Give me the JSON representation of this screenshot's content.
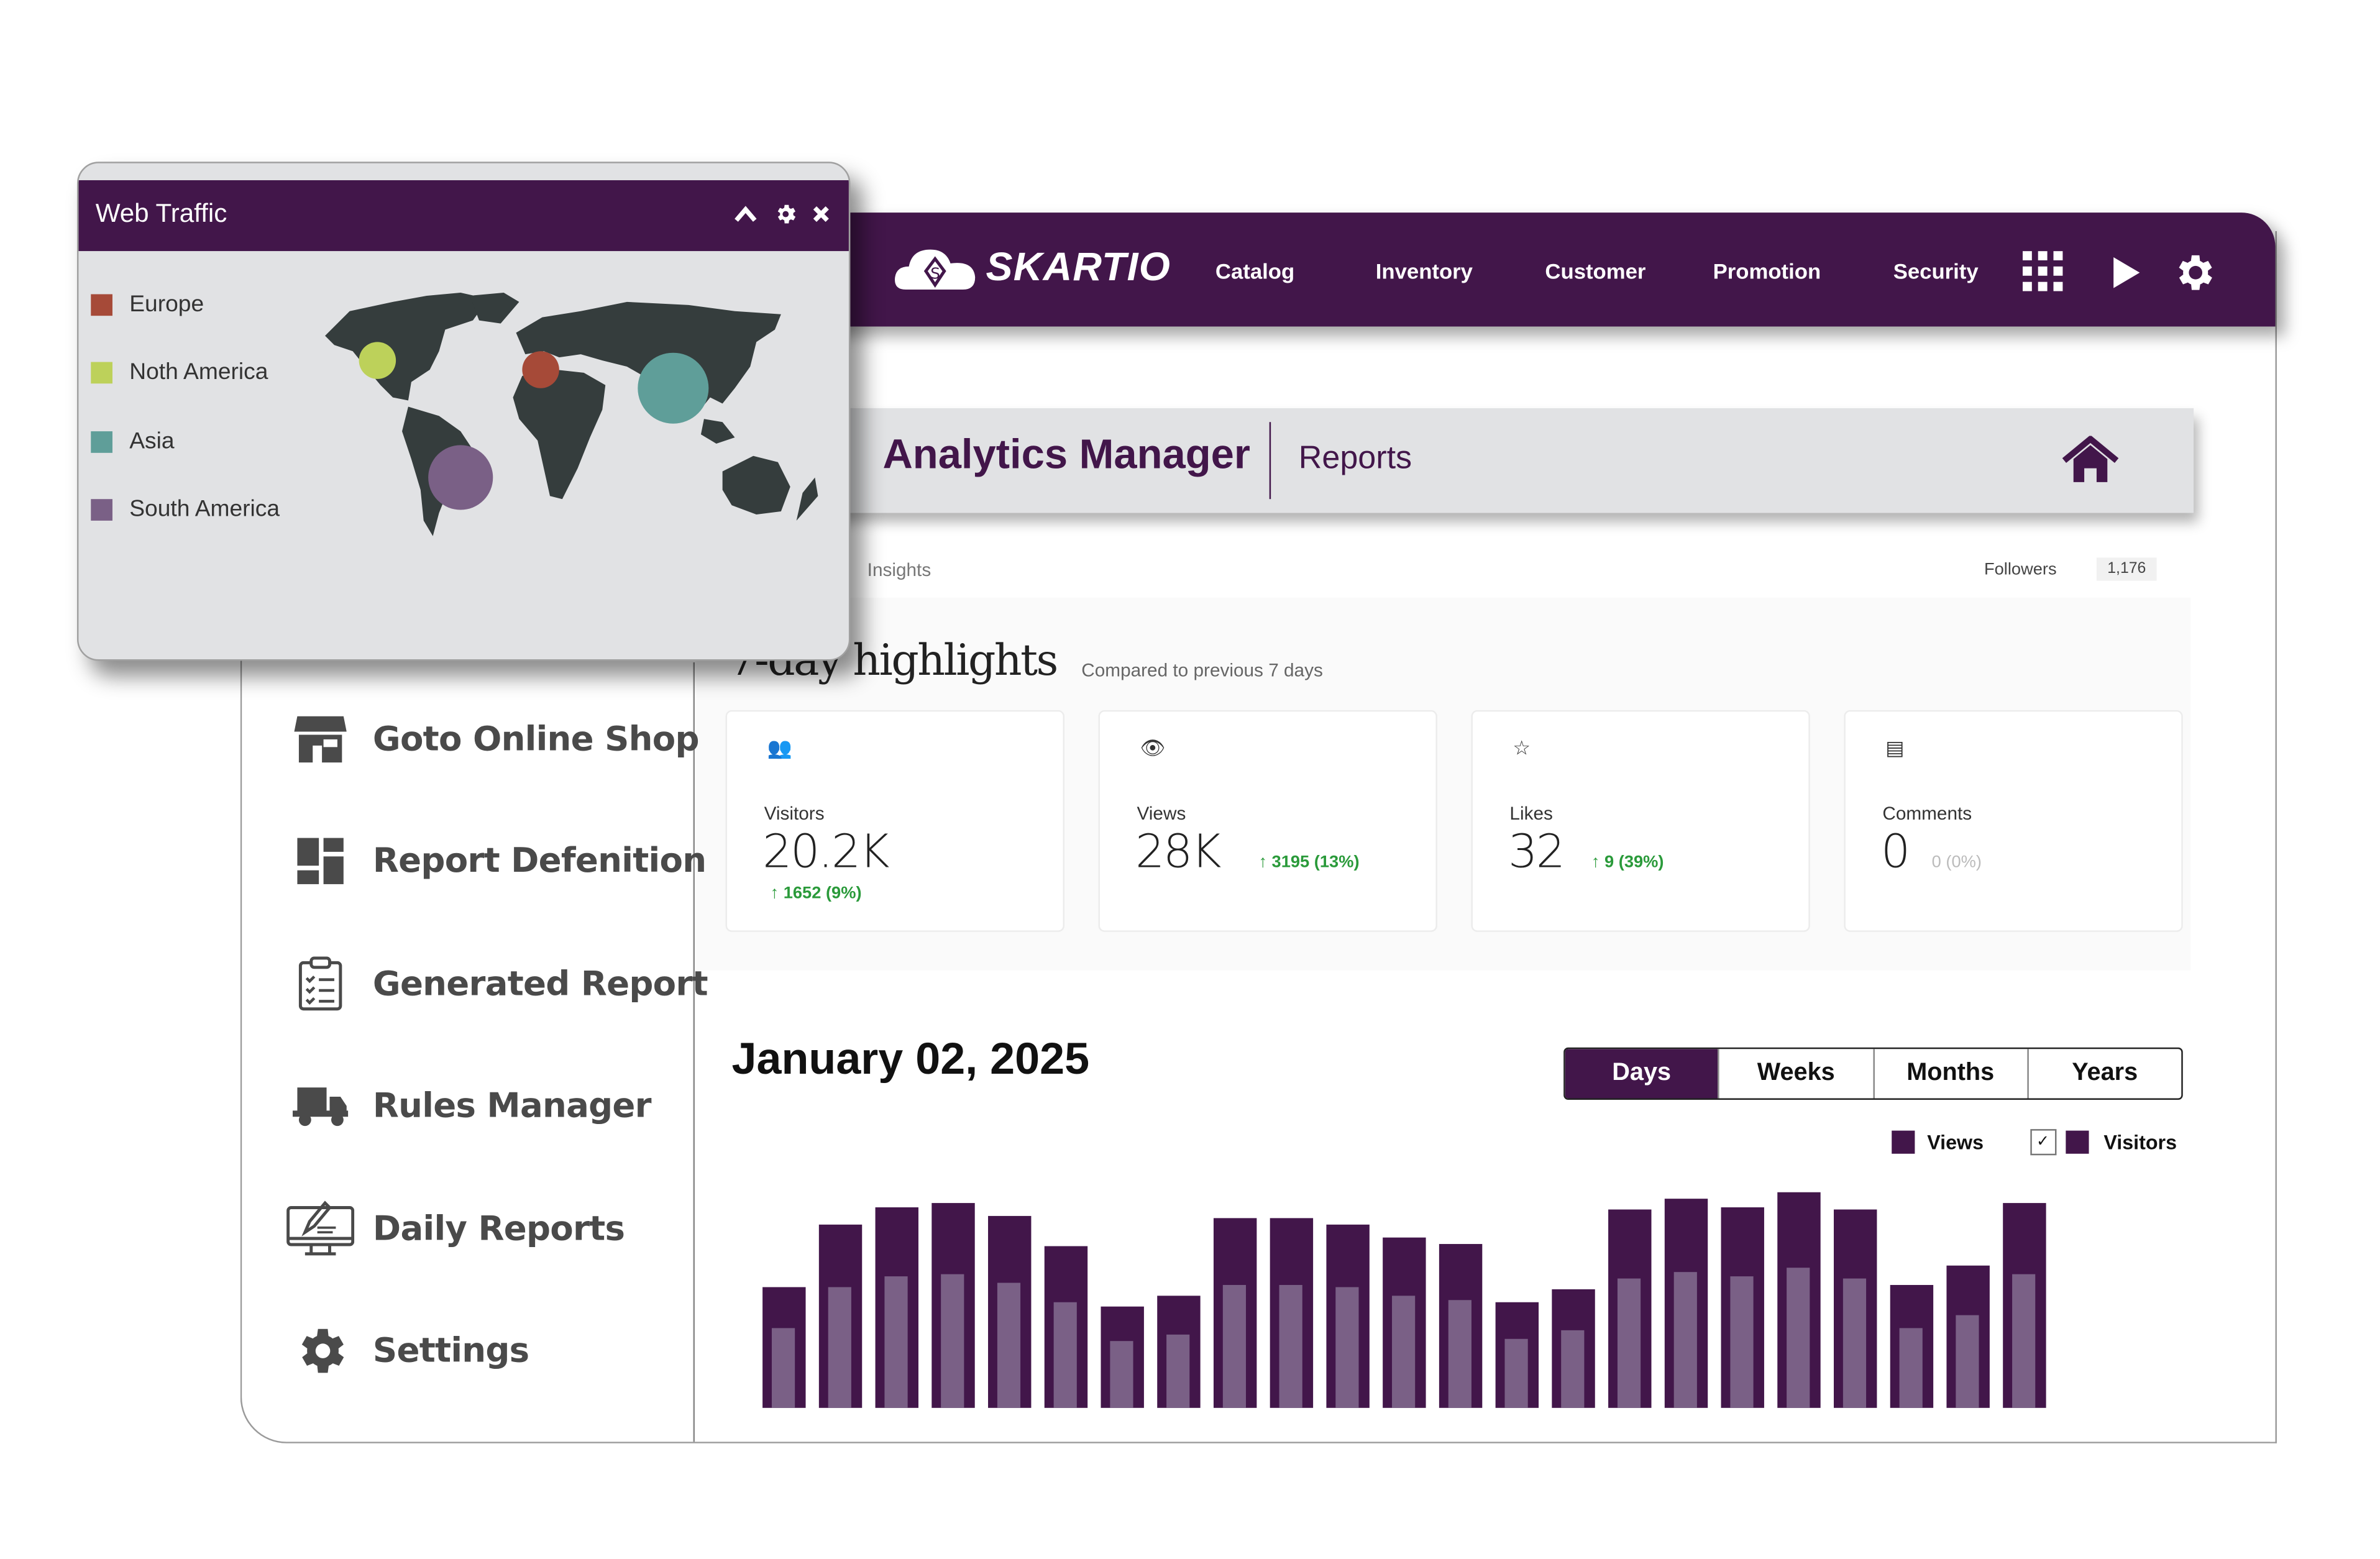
{
  "brand": {
    "name": "SKARTIO",
    "accent": "#42164a"
  },
  "nav": {
    "items": [
      "Catalog",
      "Inventory",
      "Customer",
      "Promotion",
      "Security"
    ],
    "icons": [
      "apps-grid-icon",
      "play-icon",
      "gear-icon"
    ]
  },
  "titlebar": {
    "title": "Analytics Manager",
    "subtitle": "Reports"
  },
  "insights": {
    "label": "Insights",
    "followers_label": "Followers",
    "followers_value": "1,176"
  },
  "highlights": {
    "title": "7-day highlights",
    "compare": "Compared to previous 7 days",
    "cards": [
      {
        "icon": "people-icon",
        "label": "Visitors",
        "value": "20.2K",
        "delta": "↑ 1652 (9%)"
      },
      {
        "icon": "eye-icon",
        "label": "Views",
        "value": "28K",
        "delta": "↑ 3195 (13%)"
      },
      {
        "icon": "star-icon",
        "label": "Likes",
        "value": "32",
        "delta": "↑ 9 (39%)"
      },
      {
        "icon": "comment-icon",
        "label": "Comments",
        "value": "0",
        "delta": "0 (0%)"
      }
    ]
  },
  "sidebar": {
    "items": [
      {
        "label": "Goto Online Shop",
        "icon": "storefront-icon"
      },
      {
        "label": "Report Defenition",
        "icon": "dashboard-icon"
      },
      {
        "label": "Generated Report",
        "icon": "clipboard-checklist-icon"
      },
      {
        "label": "Rules Manager",
        "icon": "truck-icon"
      },
      {
        "label": "Daily Reports",
        "icon": "monitor-edit-icon"
      },
      {
        "label": "Settings",
        "icon": "gear-icon"
      }
    ]
  },
  "report": {
    "date": "January 02, 2025",
    "ranges": [
      "Days",
      "Weeks",
      "Months",
      "Years"
    ],
    "selected_range": "Days"
  },
  "chart_data": {
    "type": "bar",
    "legend": [
      "Views",
      "Visitors"
    ],
    "legend_placement": "top-right",
    "visitors_checked": true,
    "series": [
      {
        "name": "Views",
        "color": "#42164a",
        "values": [
          56,
          85,
          93,
          95,
          89,
          75,
          47,
          52,
          88,
          88,
          85,
          79,
          76,
          49,
          55,
          92,
          97,
          93,
          100,
          92,
          57,
          66,
          95
        ]
      },
      {
        "name": "Visitors",
        "color": "#7a6086",
        "values": [
          37,
          56,
          61,
          62,
          58,
          49,
          31,
          34,
          57,
          57,
          56,
          52,
          50,
          32,
          36,
          60,
          63,
          61,
          65,
          60,
          37,
          43,
          62
        ]
      }
    ],
    "grid": false
  },
  "popup": {
    "title": "Web Traffic",
    "controls": [
      "collapse-icon",
      "gear-icon",
      "close-icon"
    ],
    "regions": [
      {
        "name": "Europe",
        "color": "#a64a38"
      },
      {
        "name": "Noth America",
        "color": "#bdd15a"
      },
      {
        "name": "Asia",
        "color": "#5f9e99"
      },
      {
        "name": "South America",
        "color": "#7a6086"
      }
    ],
    "map_color": "#353d3d"
  }
}
